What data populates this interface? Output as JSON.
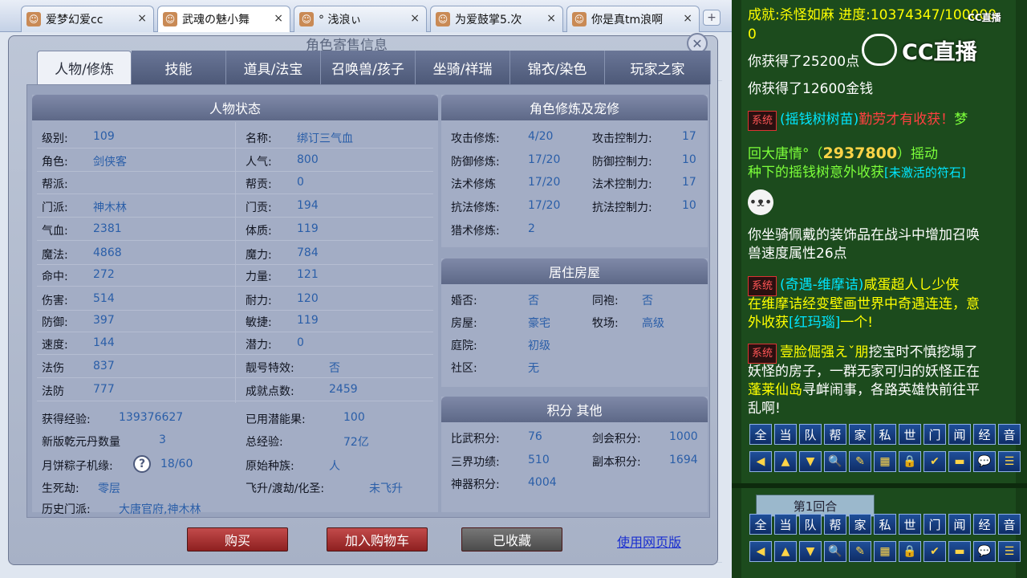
{
  "browser": {
    "tabs": [
      {
        "label": "爱梦幻爱cc",
        "icon": "avatar-icon",
        "active": false
      },
      {
        "label": "武魂の魅小舞",
        "icon": "avatar-icon",
        "active": true
      },
      {
        "label": "°  浅浪ぃ",
        "icon": "avatar-icon",
        "active": false
      },
      {
        "label": "为爱鼓掌5.次",
        "icon": "avatar-icon",
        "active": false
      },
      {
        "label": "你是真tm浪啊",
        "icon": "avatar-icon",
        "active": false
      }
    ],
    "close_glyph": "×",
    "new_tab_glyph": "+"
  },
  "dialog": {
    "title": "角色寄售信息",
    "close_glyph": "✕",
    "tabs": [
      "人物/修炼",
      "技能",
      "道具/法宝",
      "召唤兽/孩子",
      "坐骑/祥瑞",
      "锦衣/染色",
      "玩家之家"
    ],
    "status": {
      "header": "人物状态",
      "left": [
        {
          "label": "级别:",
          "value": "109"
        },
        {
          "label": "角色:",
          "value": "剑侠客"
        },
        {
          "label": "帮派:",
          "value": ""
        },
        {
          "label": "门派:",
          "value": "神木林"
        },
        {
          "label": "气血:",
          "value": "2381"
        },
        {
          "label": "魔法:",
          "value": "4868"
        },
        {
          "label": "命中:",
          "value": "272"
        },
        {
          "label": "伤害:",
          "value": "514"
        },
        {
          "label": "防御:",
          "value": "397"
        },
        {
          "label": "速度:",
          "value": "144"
        },
        {
          "label": "法伤",
          "value": "837"
        },
        {
          "label": "法防",
          "value": "777"
        }
      ],
      "right": [
        {
          "label": "名称:",
          "value": "绑订三气血"
        },
        {
          "label": "人气:",
          "value": "800"
        },
        {
          "label": "帮贡:",
          "value": "0"
        },
        {
          "label": "门贡:",
          "value": "194"
        },
        {
          "label": "体质:",
          "value": "119"
        },
        {
          "label": "魔力:",
          "value": "784"
        },
        {
          "label": "力量:",
          "value": "121"
        },
        {
          "label": "耐力:",
          "value": "120"
        },
        {
          "label": "敏捷:",
          "value": "119"
        },
        {
          "label": "潜力:",
          "value": "0"
        },
        {
          "label": "靓号特效:",
          "value": "否"
        },
        {
          "label": "成就点数:",
          "value": "2459"
        }
      ],
      "extra_left": [
        {
          "label": "获得经验:",
          "value": "139376627"
        },
        {
          "label": "新版乾元丹数量",
          "value": "3"
        },
        {
          "label": "月饼粽子机缘:",
          "value": "18/60"
        },
        {
          "label": "生死劫:",
          "value": "零层"
        },
        {
          "label": "历史门派:",
          "value": "大唐官府,神木林"
        }
      ],
      "extra_right": [
        {
          "label": "已用潜能果:",
          "value": "100"
        },
        {
          "label": "总经验:",
          "value": "72亿"
        },
        {
          "label": "原始种族:",
          "value": "人"
        },
        {
          "label": "飞升/渡劫/化圣:",
          "value": "未飞升"
        }
      ],
      "help_glyph": "?"
    },
    "cultivation": {
      "header": "角色修炼及宠修",
      "rows": [
        {
          "l1": "攻击修炼:",
          "v1": "4/20",
          "l2": "攻击控制力:",
          "v2": "17"
        },
        {
          "l1": "防御修炼:",
          "v1": "17/20",
          "l2": "防御控制力:",
          "v2": "10"
        },
        {
          "l1": "法术修炼",
          "v1": "17/20",
          "l2": "法术控制力:",
          "v2": "17"
        },
        {
          "l1": "抗法修炼:",
          "v1": "17/20",
          "l2": "抗法控制力:",
          "v2": "10"
        },
        {
          "l1": "猎术修炼:",
          "v1": "2",
          "l2": "",
          "v2": ""
        }
      ]
    },
    "housing": {
      "header": "居住房屋",
      "rows": [
        {
          "l1": "婚否:",
          "v1": "否",
          "l2": "同袍:",
          "v2": "否"
        },
        {
          "l1": "房屋:",
          "v1": "豪宅",
          "l2": "牧场:",
          "v2": "高级"
        },
        {
          "l1": "庭院:",
          "v1": "初级",
          "l2": "",
          "v2": ""
        },
        {
          "l1": "社区:",
          "v1": "无",
          "l2": "",
          "v2": ""
        }
      ]
    },
    "scores": {
      "header": "积分 其他",
      "rows": [
        {
          "l1": "比武积分:",
          "v1": "76",
          "l2": "剑会积分:",
          "v2": "1000"
        },
        {
          "l1": "三界功绩:",
          "v1": "510",
          "l2": "副本积分:",
          "v2": "1694"
        },
        {
          "l1": "神器积分:",
          "v1": "4004",
          "l2": "",
          "v2": ""
        }
      ]
    },
    "buttons": {
      "buy": "购买",
      "cart": "加入购物车",
      "collected": "已收藏",
      "web": "使用网页版"
    }
  },
  "chat": {
    "line1": "成就:杀怪如麻   进度:10374347/100000",
    "line1b": "0",
    "line2": "你获得了25200点",
    "line3": "你获得了12600金钱",
    "sys_tag": "系统",
    "msg1a": "(摇钱树树苗)",
    "msg1b": "勤劳才有收获！",
    "msg1c": "梦",
    "msg1d": "回大唐情°（",
    "msg1e": "2937800",
    "msg1f": "）摇动",
    "msg1g": "种下的摇钱树意外收获",
    "msg1h": "[未激活的符石]",
    "msg2a": "你坐骑佩戴的装饰品在战斗中增加召唤",
    "msg2b": "兽速度属性26点",
    "msg3a": "(奇遇-维摩诘)",
    "msg3b": "咸蛋超人し少侠",
    "msg3c": "在维摩诘经变壁画世界中奇遇连连，意",
    "msg3d": "外收获",
    "msg3e": "[红玛瑙]",
    "msg3f": "一个!",
    "msg4a": "壹脸倔强えˇ朋",
    "msg4b": "挖宝时不慎挖塌了",
    "msg4c": "妖怪的房子，一群无家可归的妖怪正在",
    "msg4d": "蓬莱仙岛",
    "msg4e": "寻衅闹事，各路英雄快前往平",
    "msg4f": "乱啊!",
    "channels": [
      "全",
      "当",
      "队",
      "帮",
      "家",
      "私",
      "世",
      "门",
      "闻",
      "经",
      "音"
    ],
    "tools": [
      "◀",
      "▲",
      "▼",
      "🔍",
      "✎",
      "▦",
      "🔒",
      "✔",
      "▬",
      "💬",
      "☰"
    ],
    "round": "第1回合",
    "cc_logo": "CC直播",
    "cc_small": "CC直播"
  },
  "colors": {
    "accent_green": "#7cff3a",
    "accent_yellow": "#ffff00",
    "accent_cyan": "#00e6ff",
    "red": "#ff4040",
    "white": "#ffffff"
  }
}
